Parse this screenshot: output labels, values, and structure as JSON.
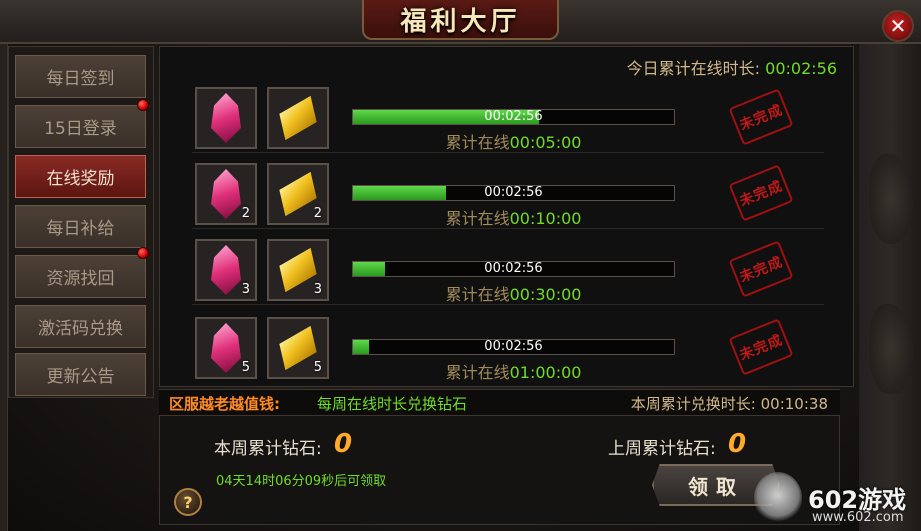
{
  "window": {
    "title": "福利大厅",
    "close_label": "✕"
  },
  "sidebar": {
    "items": [
      {
        "label": "每日签到",
        "active": false,
        "dot": false
      },
      {
        "label": "15日登录",
        "active": false,
        "dot": true
      },
      {
        "label": "在线奖励",
        "active": true,
        "dot": false
      },
      {
        "label": "每日补给",
        "active": false,
        "dot": true
      },
      {
        "label": "资源找回",
        "active": false,
        "dot": false
      },
      {
        "label": "激活码兑换",
        "active": false,
        "dot": false
      },
      {
        "label": "更新公告",
        "active": false,
        "dot": false
      }
    ]
  },
  "header": {
    "today_label": "今日累计在线时长: ",
    "today_value": "00:02:56"
  },
  "rewards": [
    {
      "gem_count": "",
      "gold_count": "",
      "elapsed": "00:02:56",
      "progress": 0.58,
      "need_prefix": "累计在线",
      "need_time": "00:05:00",
      "status": "未完成"
    },
    {
      "gem_count": "2",
      "gold_count": "2",
      "elapsed": "00:02:56",
      "progress": 0.29,
      "need_prefix": "累计在线",
      "need_time": "00:10:00",
      "status": "未完成"
    },
    {
      "gem_count": "3",
      "gold_count": "3",
      "elapsed": "00:02:56",
      "progress": 0.1,
      "need_prefix": "累计在线",
      "need_time": "00:30:00",
      "status": "未完成"
    },
    {
      "gem_count": "5",
      "gold_count": "5",
      "elapsed": "00:02:56",
      "progress": 0.05,
      "need_prefix": "累计在线",
      "need_time": "01:00:00",
      "status": "未完成"
    }
  ],
  "exchange": {
    "title": "区服越老越值钱:",
    "desc": "每周在线时长兑换钻石",
    "week_label": "本周累计兑换时长:",
    "week_value": "00:10:38",
    "this_week_label": "本周累计钻石:",
    "this_week_value": "0",
    "last_week_label": "上周累计钻石:",
    "last_week_value": "0",
    "countdown": "04天14时06分09秒后可领取",
    "claim_label": "领取",
    "help_label": "?"
  },
  "watermark": {
    "brand": "602游戏",
    "url": "www.602.com"
  },
  "colors": {
    "progress": "#3cbc2a",
    "accent_green": "#6fdc2a",
    "accent_orange": "#ffaa2a",
    "stamp_red": "#c01818"
  }
}
